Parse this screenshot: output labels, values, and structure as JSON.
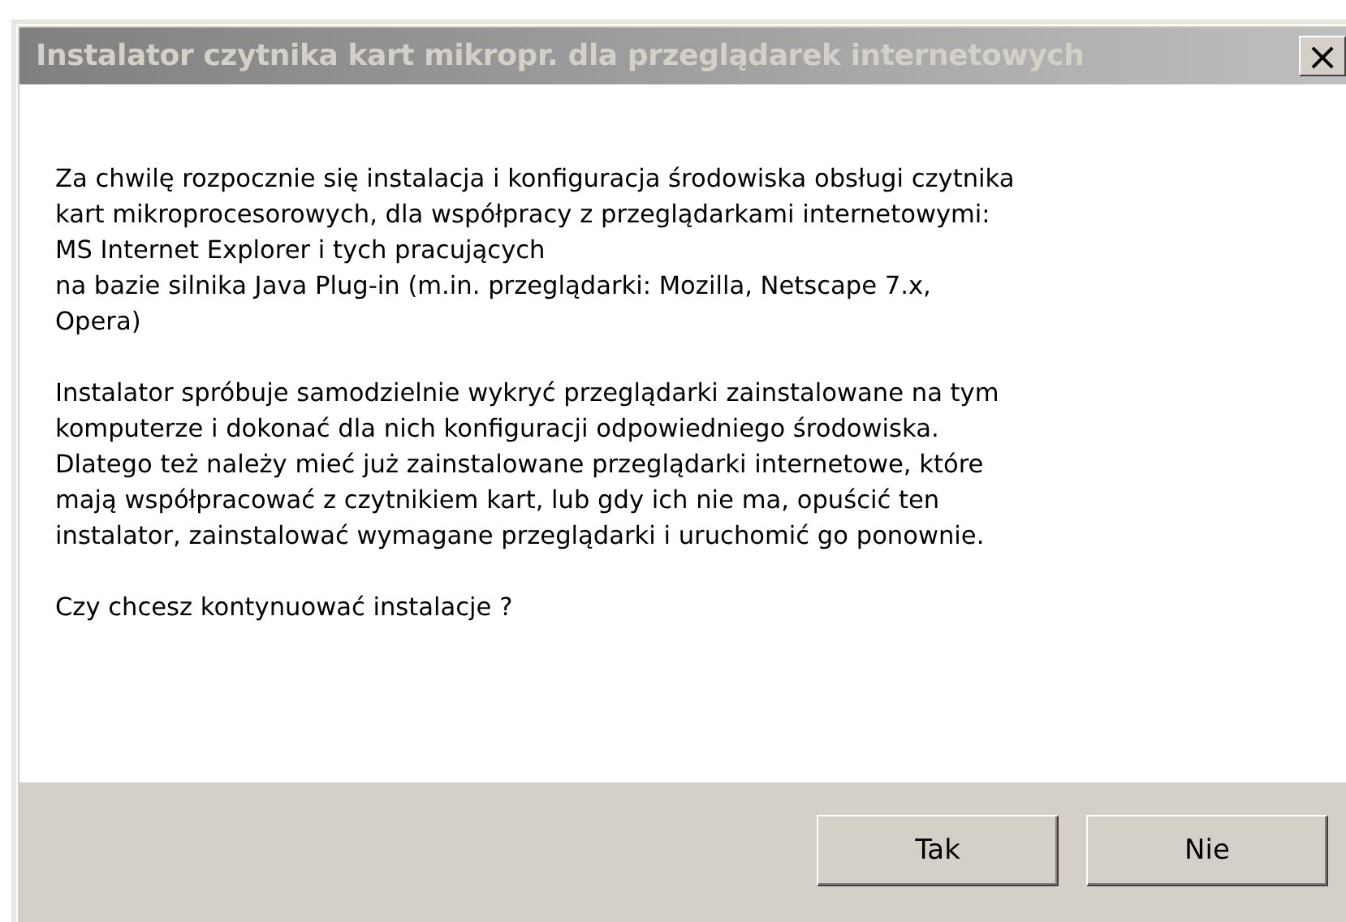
{
  "window": {
    "title": "Instalator czytnika kart mikropr. dla przeglądarek internetowych",
    "close": "×"
  },
  "paragraphs": [
    "Za chwilę rozpocznie się instalacja i konfiguracja środowiska obsługi czytnika\nkart mikroprocesorowych, dla współpracy z przeglądarkami internetowymi:\nMS Internet Explorer i tych pracujących\nna bazie silnika Java Plug-in (m.in. przeglądarki: Mozilla, Netscape 7.x,\nOpera)",
    "Instalator spróbuje samodzielnie wykryć przeglądarki zainstalowane na tym\nkomputerze i dokonać dla nich konfiguracji odpowiedniego środowiska.\nDlatego też należy mieć już zainstalowane przeglądarki internetowe, które\nmają współpracować z czytnikiem kart, lub gdy ich nie ma, opuścić ten\ninstalator, zainstalować wymagane przeglądarki i uruchomić go ponownie.",
    "Czy chcesz kontynuować instalacje ?"
  ],
  "buttons": [
    "Tak",
    "Nie"
  ]
}
